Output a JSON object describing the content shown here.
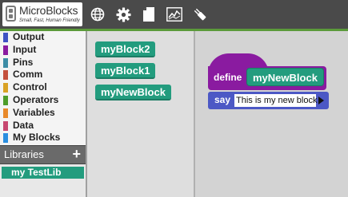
{
  "app": {
    "title": "MicroBlocks",
    "tagline": "Small, Fast, Human Friendly"
  },
  "toolbar": {
    "icons": [
      "globe-icon",
      "gear-icon",
      "file-icon",
      "graph-icon",
      "usb-plug-icon"
    ]
  },
  "categories": [
    {
      "label": "Output",
      "color": "#3f52c4"
    },
    {
      "label": "Input",
      "color": "#8a1ba0"
    },
    {
      "label": "Pins",
      "color": "#3d8da6"
    },
    {
      "label": "Comm",
      "color": "#c4503c"
    },
    {
      "label": "Control",
      "color": "#d9a224"
    },
    {
      "label": "Operators",
      "color": "#4e9c2a"
    },
    {
      "label": "Variables",
      "color": "#e8892a"
    },
    {
      "label": "Data",
      "color": "#c7476f"
    },
    {
      "label": "My Blocks",
      "color": "#2a8ee0"
    }
  ],
  "libraries": {
    "label": "Libraries",
    "add_label": "+",
    "items": [
      {
        "label": "my TestLib"
      }
    ]
  },
  "palette": {
    "blocks": [
      {
        "label": "myBlock2"
      },
      {
        "label": "myBlock1"
      },
      {
        "label": "myNewBlock"
      }
    ]
  },
  "script": {
    "define_label": "define",
    "block_name": "myNewBlock",
    "say_label": "say",
    "say_value": "This is my new block"
  },
  "colors": {
    "topbar": "#4a4a4a",
    "accent_strip": "#5b9a3a",
    "my_blocks": "#239c7e",
    "define_hat": "#8a1ba0",
    "say_block": "#4c58c5"
  }
}
